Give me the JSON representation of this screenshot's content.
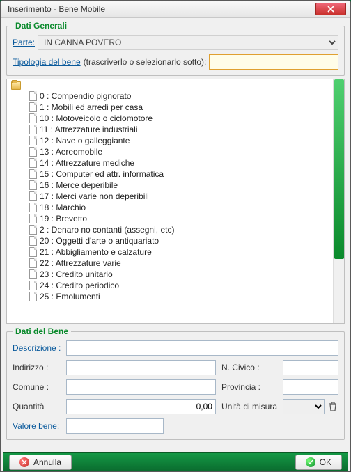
{
  "window": {
    "title": "Inserimento - Bene Mobile"
  },
  "fieldset1": {
    "legend": "Dati Generali",
    "parte_label": "Parte:",
    "parte_value": "IN CANNA POVERO",
    "tipologia_label": "Tipologia del bene",
    "tipologia_hint": "(trascriverlo o selezionarlo sotto):",
    "tipologia_value": ""
  },
  "tree": {
    "items": [
      "0 : Compendio pignorato",
      "1 : Mobili ed arredi per casa",
      "10 : Motoveicolo o ciclomotore",
      "11 : Attrezzature industriali",
      "12 : Nave o galleggiante",
      "13 : Aereomobile",
      "14 : Attrezzature mediche",
      "15 : Computer ed attr. informatica",
      "16 : Merce deperibile",
      "17 : Merci varie non deperibili",
      "18 : Marchio",
      "19 : Brevetto",
      "2 : Denaro no contanti (assegni, etc)",
      "20 : Oggetti d'arte o antiquariato",
      "21 : Abbigliamento e calzature",
      "22 : Attrezzature varie",
      "23 : Credito unitario",
      "24 : Credito periodico",
      "25 : Emolumenti"
    ]
  },
  "fieldset2": {
    "legend": "Dati del Bene",
    "descrizione_label": "Descrizione :",
    "descrizione_value": "",
    "indirizzo_label": "Indirizzo :",
    "indirizzo_value": "",
    "civico_label": "N. Civico :",
    "civico_value": "",
    "comune_label": "Comune :",
    "comune_value": "",
    "provincia_label": "Provincia :",
    "provincia_value": "",
    "quantita_label": "Quantità",
    "quantita_value": "0,00",
    "unita_label": "Unità di misura",
    "unita_value": "",
    "valore_label": "Valore bene:",
    "valore_value": ""
  },
  "footer": {
    "annulla": "Annulla",
    "ok": "OK"
  }
}
